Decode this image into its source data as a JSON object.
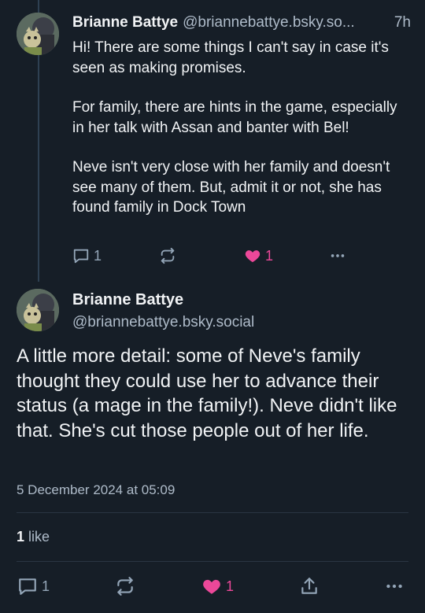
{
  "reply": {
    "author_name": "Brianne Battye",
    "author_handle": "@briannebattye.bsky.so...",
    "time": "7h",
    "paragraphs": [
      "Hi! There are some things I can't say in case it's seen as making promises.",
      "For family, there are hints in the game, especially in her talk with Assan and banter with Bel!",
      "Neve isn't very close with her family and doesn't see many of them. But, admit it or not, she has found family in Dock Town"
    ],
    "reply_count": "1",
    "like_count": "1"
  },
  "post": {
    "author_name": "Brianne Battye",
    "author_handle": "@briannebattye.bsky.social",
    "text": "A little more detail: some of Neve's family thought they could use her to advance their status (a mage in the family!). Neve didn't like that. She's cut those people out of her life.",
    "date": "5 December 2024 at 05:09",
    "likes_count": "1",
    "likes_label": "like",
    "reply_count": "1",
    "like_count": "1"
  },
  "colors": {
    "background": "#161e27",
    "like_accent": "#ec4899",
    "muted": "#93a5b7"
  },
  "icons": {
    "reply": "comment-icon",
    "repost": "repost-icon",
    "like": "heart-icon",
    "share": "share-icon",
    "more": "more-icon"
  }
}
